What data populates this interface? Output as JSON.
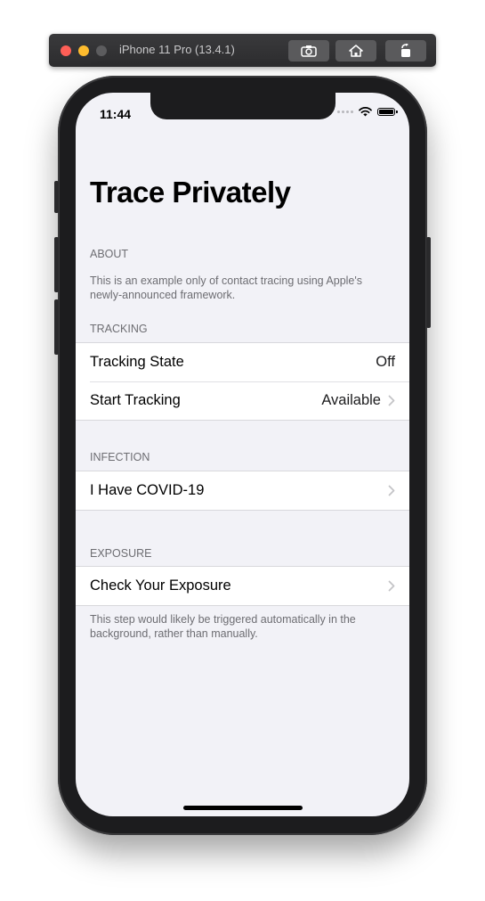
{
  "simulator": {
    "title": "iPhone 11 Pro (13.4.1)",
    "buttons": [
      "screenshot-icon",
      "home-icon",
      "rotate-icon"
    ]
  },
  "status_bar": {
    "time": "11:44",
    "icons": [
      "cellular-dots-icon",
      "wifi-icon",
      "battery-icon"
    ]
  },
  "nav": {
    "large_title": "Trace Privately"
  },
  "sections": {
    "about": {
      "header": "ABOUT",
      "footer": "This is an example only of contact tracing using Apple's newly-announced framework."
    },
    "tracking": {
      "header": "TRACKING",
      "rows": [
        {
          "label": "Tracking State",
          "value": "Off"
        },
        {
          "label": "Start Tracking",
          "value": "Available"
        }
      ]
    },
    "infection": {
      "header": "INFECTION",
      "rows": [
        {
          "label": "I Have COVID-19"
        }
      ]
    },
    "exposure": {
      "header": "EXPOSURE",
      "rows": [
        {
          "label": "Check Your Exposure"
        }
      ],
      "footer": "This step would likely be triggered automatically in the background, rather than manually."
    }
  },
  "colors": {
    "background": "#f2f2f7",
    "cell": "#ffffff",
    "secondary_text": "#6d6d72",
    "chevron": "#c4c4c7"
  }
}
